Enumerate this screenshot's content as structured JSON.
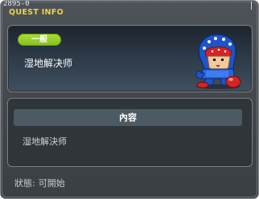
{
  "window": {
    "quest_id": "2895-0",
    "title": "QUEST INFO"
  },
  "quest": {
    "category": "一般",
    "name": "湿地解决师",
    "npc": "blue-hooded-character"
  },
  "content": {
    "header": "內容",
    "text": "湿地解決师"
  },
  "status": {
    "label": "狀態:",
    "value": "可開始"
  },
  "colors": {
    "title": "#f0d040",
    "badge": "#84c21e",
    "background": "#43484d",
    "content_header": "#4c5a63"
  }
}
